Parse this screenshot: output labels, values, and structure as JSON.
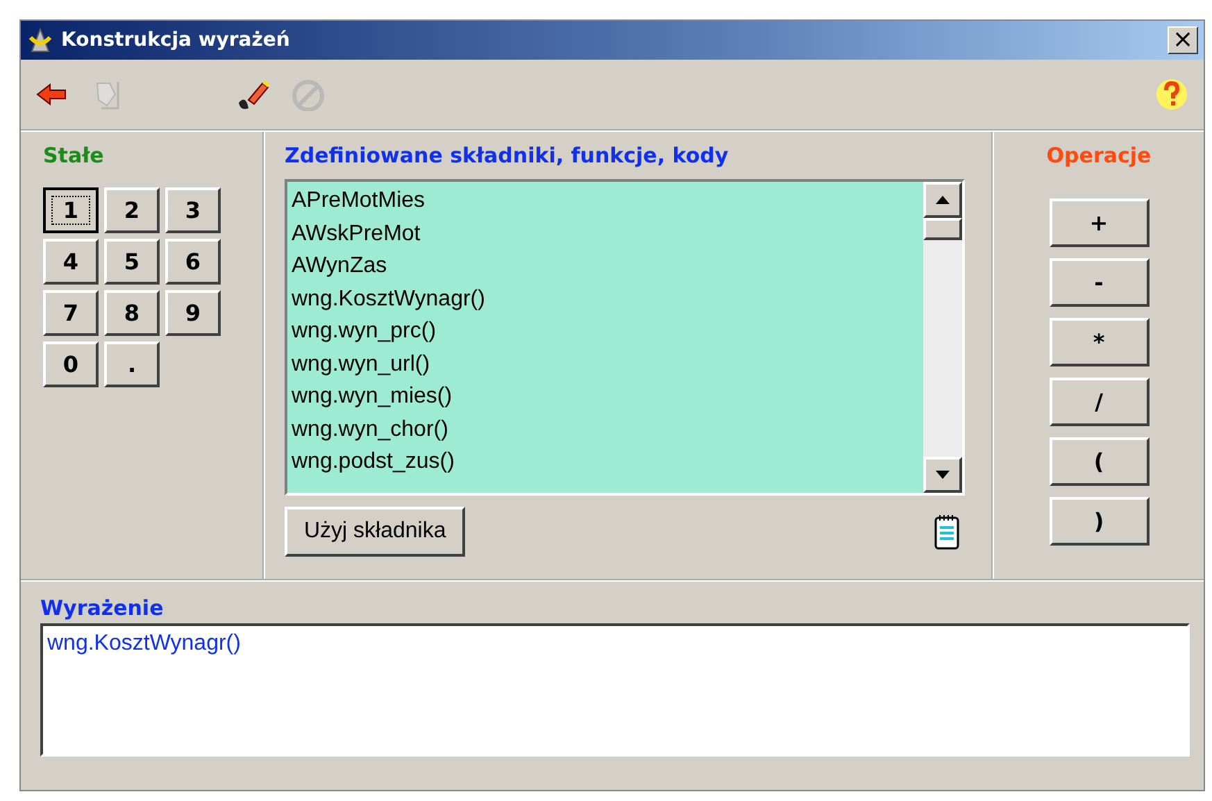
{
  "window": {
    "title": "Konstrukcja wyrażeń",
    "close": "×"
  },
  "toolbar": [
    {
      "kind": "back",
      "disabled": false
    },
    {
      "kind": "edit",
      "disabled": true
    },
    {
      "kind": "eraser",
      "disabled": false
    },
    {
      "kind": "cancel",
      "disabled": true
    }
  ],
  "constants": {
    "title": "Stałe",
    "keys": [
      {
        "label": "1",
        "focused": true
      },
      {
        "label": "2",
        "focused": false
      },
      {
        "label": "3",
        "focused": false
      },
      {
        "label": "4",
        "focused": false
      },
      {
        "label": "5",
        "focused": false
      },
      {
        "label": "6",
        "focused": false
      },
      {
        "label": "7",
        "focused": false
      },
      {
        "label": "8",
        "focused": false
      },
      {
        "label": "9",
        "focused": false
      },
      {
        "label": "0",
        "focused": false
      },
      {
        "label": ".",
        "focused": false
      }
    ]
  },
  "components": {
    "title": "Zdefiniowane składniki, funkcje, kody",
    "items": [
      "APreMotMies",
      "AWskPreMot",
      "AWynZas",
      "wng.KosztWynagr()",
      "wng.wyn_prc()",
      "wng.wyn_url()",
      "wng.wyn_mies()",
      "wng.wyn_chor()",
      "wng.podst_zus()"
    ],
    "use_button": "Użyj składnika"
  },
  "operations": {
    "title": "Operacje",
    "buttons": [
      "+",
      "-",
      "*",
      "/",
      "(",
      ")"
    ]
  },
  "expression": {
    "title": "Wyrażenie",
    "value": "wng.KosztWynagr()"
  }
}
